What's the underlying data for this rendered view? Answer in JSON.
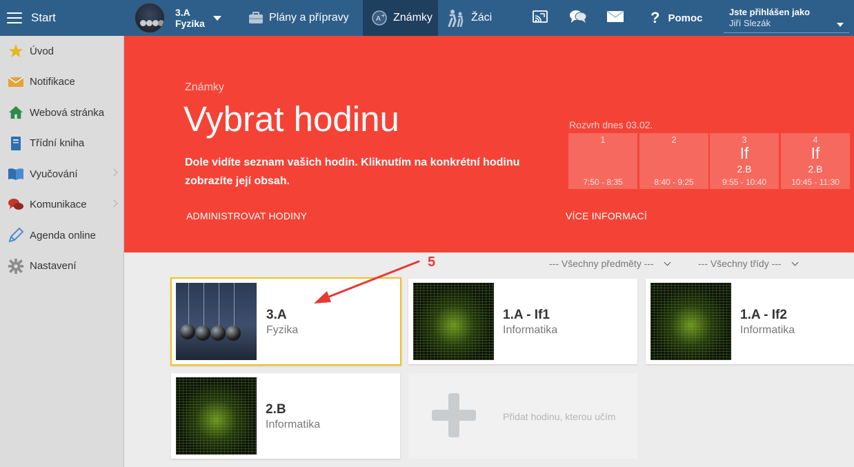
{
  "topbar": {
    "start_label": "Start",
    "class_name": "3.A",
    "class_subject": "Fyzika",
    "nav": [
      {
        "label": "Plány a přípravy",
        "icon": "briefcase-icon"
      },
      {
        "label": "Známky",
        "icon": "grade-icon"
      },
      {
        "label": "Žáci",
        "icon": "students-icon"
      }
    ],
    "help_label": "Pomoc",
    "login_label": "Jste přihlášen jako",
    "login_user": "Jiří Slezák"
  },
  "sidebar": {
    "items": [
      {
        "label": "Úvod",
        "icon": "star-icon"
      },
      {
        "label": "Notifikace",
        "icon": "envelope-icon"
      },
      {
        "label": "Webová stránka",
        "icon": "house-icon"
      },
      {
        "label": "Třídní kniha",
        "icon": "book-icon"
      },
      {
        "label": "Vyučování",
        "icon": "open-book-icon"
      },
      {
        "label": "Komunikace",
        "icon": "chat-icon"
      },
      {
        "label": "Agenda online",
        "icon": "pencil-icon"
      },
      {
        "label": "Nastavení",
        "icon": "gear-icon"
      }
    ]
  },
  "hero": {
    "kicker": "Známky",
    "title": "Vybrat hodinu",
    "desc_line1": "Dole vidíte seznam vašich hodin. Kliknutím na konkrétní hodinu",
    "desc_line2": "zobrazíte její obsah.",
    "admin_link": "ADMINISTROVAT HODINY",
    "more_link": "VÍCE INFORMACÍ",
    "schedule_title": "Rozvrh dnes 03.02.",
    "schedule": [
      {
        "num": "1",
        "subject": "",
        "class": "",
        "time": "7:50 - 8:35"
      },
      {
        "num": "2",
        "subject": "",
        "class": "",
        "time": "8:40 - 9:25"
      },
      {
        "num": "3",
        "subject": "If",
        "class": "2.B",
        "time": "9:55 - 10:40"
      },
      {
        "num": "4",
        "subject": "If",
        "class": "2.B",
        "time": "10:45 - 11:30"
      }
    ]
  },
  "filters": {
    "subjects": "--- Všechny předměty ---",
    "classes": "--- Všechny třídy ---"
  },
  "cards": [
    {
      "name": "3.A",
      "subject": "Fyzika"
    },
    {
      "name": "1.A - If1",
      "subject": "Informatika"
    },
    {
      "name": "1.A - If2",
      "subject": "Informatika"
    },
    {
      "name": "2.B",
      "subject": "Informatika"
    }
  ],
  "add_card_label": "Přidat hodinu, kterou učím",
  "annotation": {
    "number": "5",
    "color": "#e53935"
  },
  "colors": {
    "topbar": "#2e5f8a",
    "hero": "#f44336",
    "highlight": "#f3c11c"
  }
}
